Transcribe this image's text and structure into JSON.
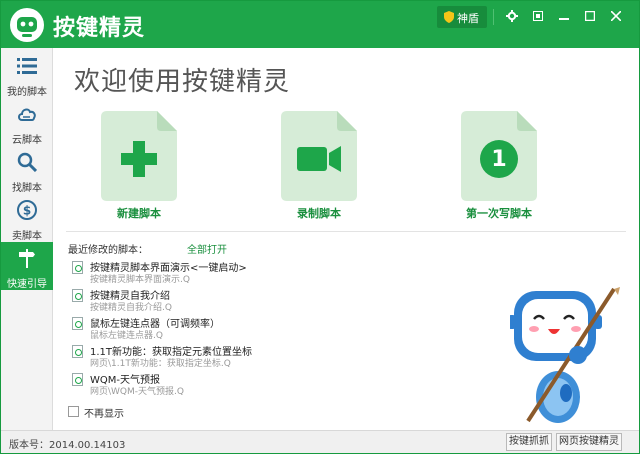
{
  "app": {
    "title": "按键精灵",
    "badge_label": "神盾"
  },
  "titlebar": {
    "icons": [
      "gear-icon",
      "restore-icon",
      "minimize-icon",
      "maximize-icon",
      "close-icon"
    ]
  },
  "sidebar": {
    "items": [
      {
        "label": "我的脚本",
        "icon": "list-icon"
      },
      {
        "label": "云脚本",
        "icon": "cloud-icon"
      },
      {
        "label": "找脚本",
        "icon": "search-icon"
      },
      {
        "label": "卖脚本",
        "icon": "dollar-icon"
      },
      {
        "label": "快速引导",
        "icon": "signpost-icon",
        "active": true
      }
    ]
  },
  "main": {
    "welcome": "欢迎使用按键精灵",
    "cards": [
      {
        "label": "新建脚本",
        "icon": "plus-icon"
      },
      {
        "label": "录制脚本",
        "icon": "video-camera-icon"
      },
      {
        "label": "第一次写脚本",
        "icon": "number-one-icon",
        "number": "1"
      }
    ],
    "recent_header": "最近修改的脚本：",
    "open_all": "全部打开",
    "recent": [
      {
        "title": "按键精灵脚本界面演示<一键启动>",
        "path": "按键精灵脚本界面演示.Q"
      },
      {
        "title": "按键精灵自我介绍",
        "path": "按键精灵自我介绍.Q"
      },
      {
        "title": "鼠标左键连点器（可调频率）",
        "path": "鼠标左键连点器.Q"
      },
      {
        "title": "1.1T新功能：获取指定元素位置坐标",
        "path": "网页\\1.1T新功能：获取指定坐标.Q"
      },
      {
        "title": "WQM-天气预报",
        "path": "网页\\WQM-天气预报.Q"
      }
    ],
    "no_show_label": "不再显示"
  },
  "statusbar": {
    "version": "版本号：2014.00.14103",
    "btn_capture": "按键抓抓",
    "btn_web": "网页按键精灵"
  },
  "colors": {
    "brand": "#1ea64a",
    "card_bg": "#d6ecd7",
    "card_icon": "#1ea64a"
  }
}
